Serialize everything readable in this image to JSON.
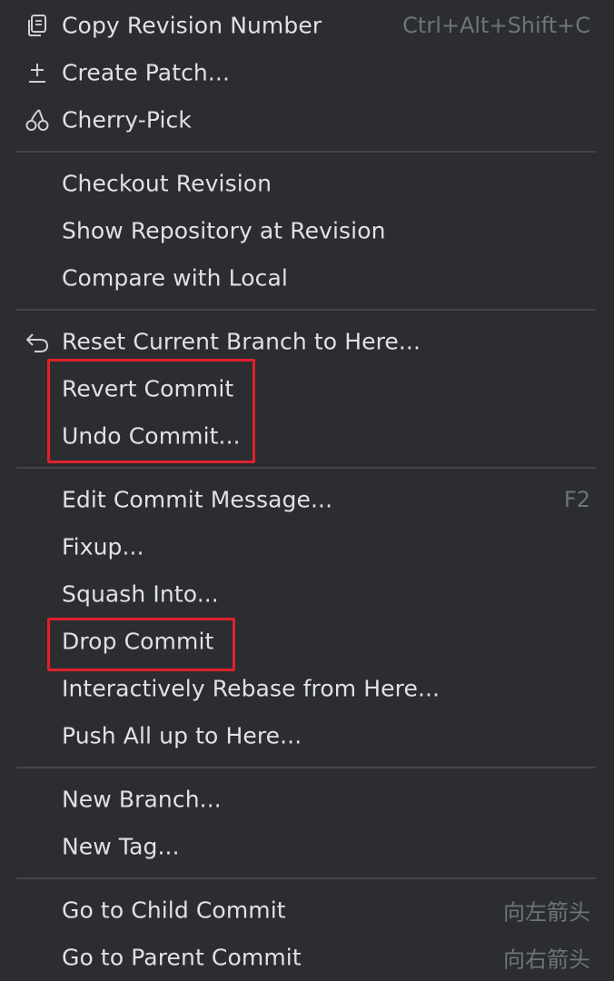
{
  "menu": {
    "items": [
      {
        "label": "Copy Revision Number",
        "shortcut": "Ctrl+Alt+Shift+C",
        "icon": "copy-icon"
      },
      {
        "label": "Create Patch...",
        "icon": "patch-icon"
      },
      {
        "label": "Cherry-Pick",
        "icon": "cherry-icon"
      },
      {
        "label": "Checkout Revision"
      },
      {
        "label": "Show Repository at Revision"
      },
      {
        "label": "Compare with Local"
      },
      {
        "label": "Reset Current Branch to Here...",
        "icon": "undo-arrow-icon"
      },
      {
        "label": "Revert Commit"
      },
      {
        "label": "Undo Commit..."
      },
      {
        "label": "Edit Commit Message...",
        "shortcut": "F2"
      },
      {
        "label": "Fixup..."
      },
      {
        "label": "Squash Into..."
      },
      {
        "label": "Drop Commit"
      },
      {
        "label": "Interactively Rebase from Here..."
      },
      {
        "label": "Push All up to Here..."
      },
      {
        "label": "New Branch..."
      },
      {
        "label": "New Tag..."
      },
      {
        "label": "Go to Child Commit",
        "shortcut": "向左箭头"
      },
      {
        "label": "Go to Parent Commit",
        "shortcut": "向右箭头"
      }
    ]
  },
  "colors": {
    "background": "#2b2d30",
    "text": "#dfe1e5",
    "shortcut_text": "#6f737a",
    "separator": "#43454a",
    "highlight_border": "#e0202b"
  }
}
